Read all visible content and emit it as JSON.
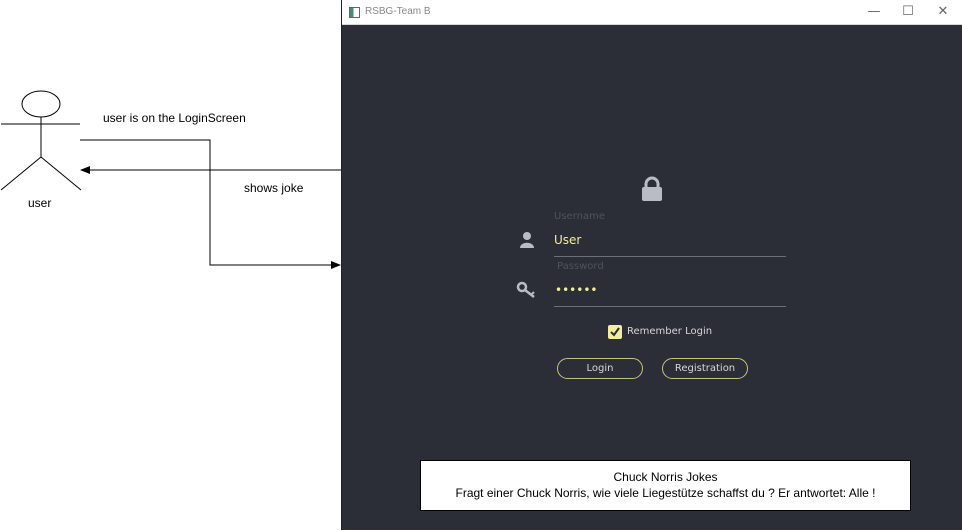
{
  "diagram": {
    "actor_label": "user",
    "arrow_to_app_label": "user is on the  LoginScreen",
    "arrow_from_app_label": "shows joke"
  },
  "window": {
    "title": "RSBG-Team B",
    "controls": {
      "minimize": "—",
      "maximize": "☐",
      "close": "✕"
    }
  },
  "login": {
    "lock_icon": "lock-icon",
    "username": {
      "label": "Username",
      "value": "User",
      "icon": "user-icon"
    },
    "password": {
      "label": "Password",
      "value": "••••••",
      "icon": "key-icon"
    },
    "remember_login": {
      "label": "Remember Login",
      "checked": true
    },
    "login_button": "Login",
    "registration_button": "Registration"
  },
  "joke_box": {
    "title": "Chuck Norris Jokes",
    "text": "Fragt einer Chuck Norris, wie viele Liegestütze schaffst du ? Er antwortet: Alle !"
  },
  "colors": {
    "window_background": "#2b2e36",
    "accent_yellow": "#f2ee9c",
    "icon_gray": "#b9bcc2"
  }
}
